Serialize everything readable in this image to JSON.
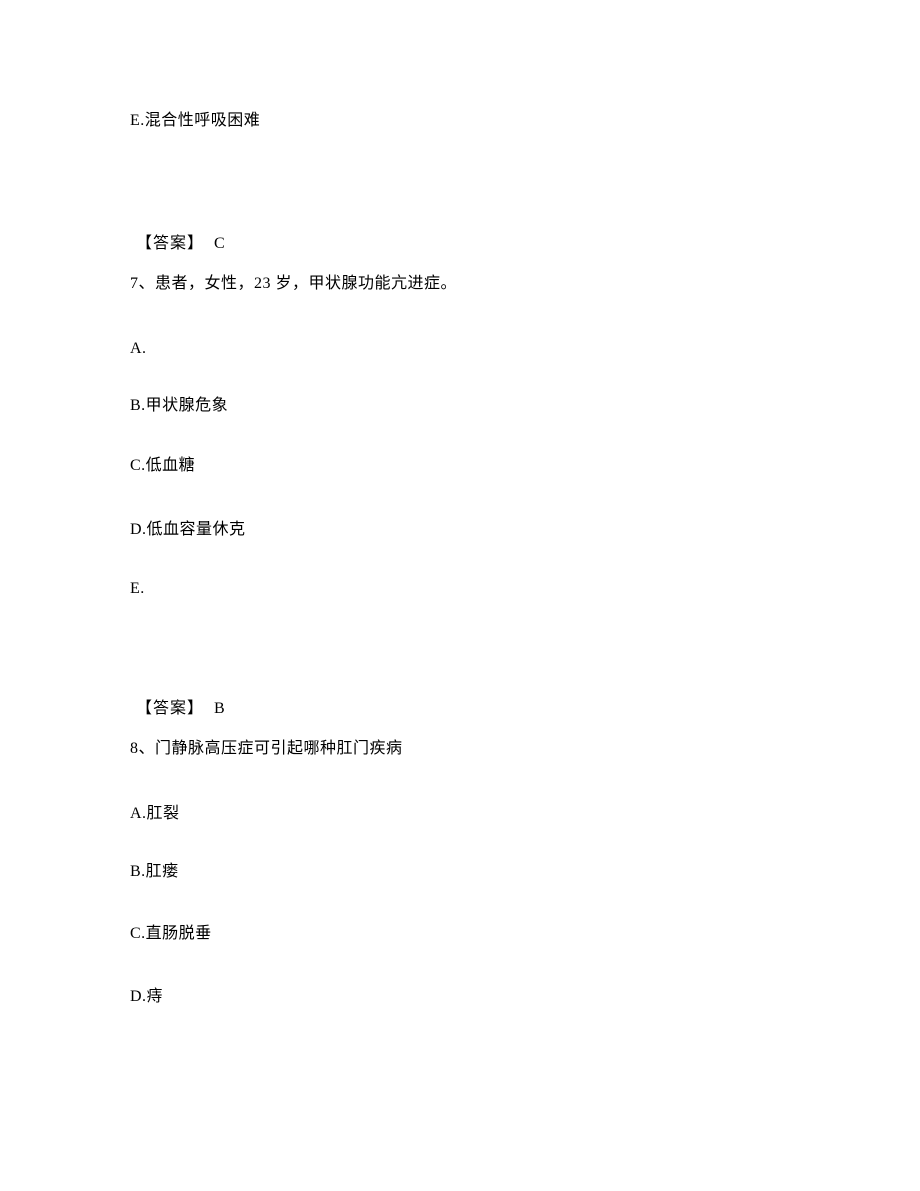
{
  "line_e_top": "E.混合性呼吸困难",
  "answer6_label": "【答案】",
  "answer6_value": "C",
  "q7": "7、患者，女性，23 岁，甲状腺功能亢进症。",
  "q7_options": {
    "A": "A.",
    "B": "B.甲状腺危象",
    "C": "C.低血糖",
    "D": "D.低血容量休克",
    "E": "E."
  },
  "answer7_label": "【答案】",
  "answer7_value": "B",
  "q8": "8、门静脉高压症可引起哪种肛门疾病",
  "q8_options": {
    "A": "A.肛裂",
    "B": "B.肛瘘",
    "C": "C.直肠脱垂",
    "D": "D.痔"
  }
}
